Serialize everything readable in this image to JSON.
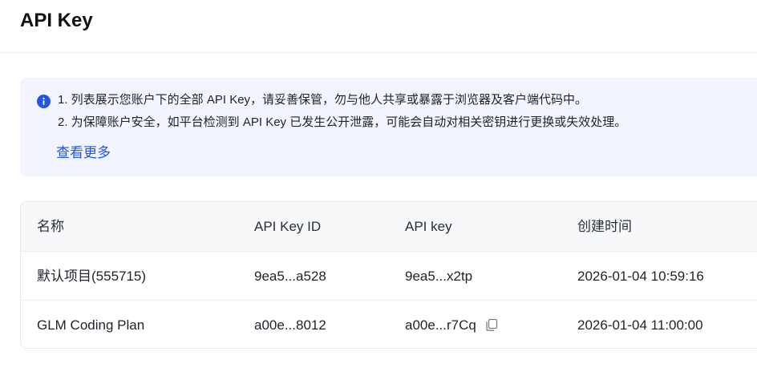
{
  "header": {
    "title": "API Key"
  },
  "notice": {
    "icon": "info-icon",
    "accent": "#2254e6",
    "line1": "1. 列表展示您账户下的全部 API Key，请妥善保管，勿与他人共享或暴露于浏览器及客户端代码中。",
    "line2": "2. 为保障账户安全，如平台检测到 API Key 已发生公开泄露，可能会自动对相关密钥进行更换或失效处理。",
    "more_link": "查看更多"
  },
  "table": {
    "columns": [
      "名称",
      "API Key ID",
      "API key",
      "创建时间"
    ],
    "rows": [
      {
        "name": "默认项目(555715)",
        "key_id": "9ea5...a528",
        "key": "9ea5...x2tp",
        "created": "2026-01-04 10:59:16"
      },
      {
        "name": "GLM Coding Plan",
        "key_id": "a00e...8012",
        "key": "a00e...r7Cq",
        "created": "2026-01-04 11:00:00"
      }
    ],
    "copy_icon": "copy-icon"
  }
}
